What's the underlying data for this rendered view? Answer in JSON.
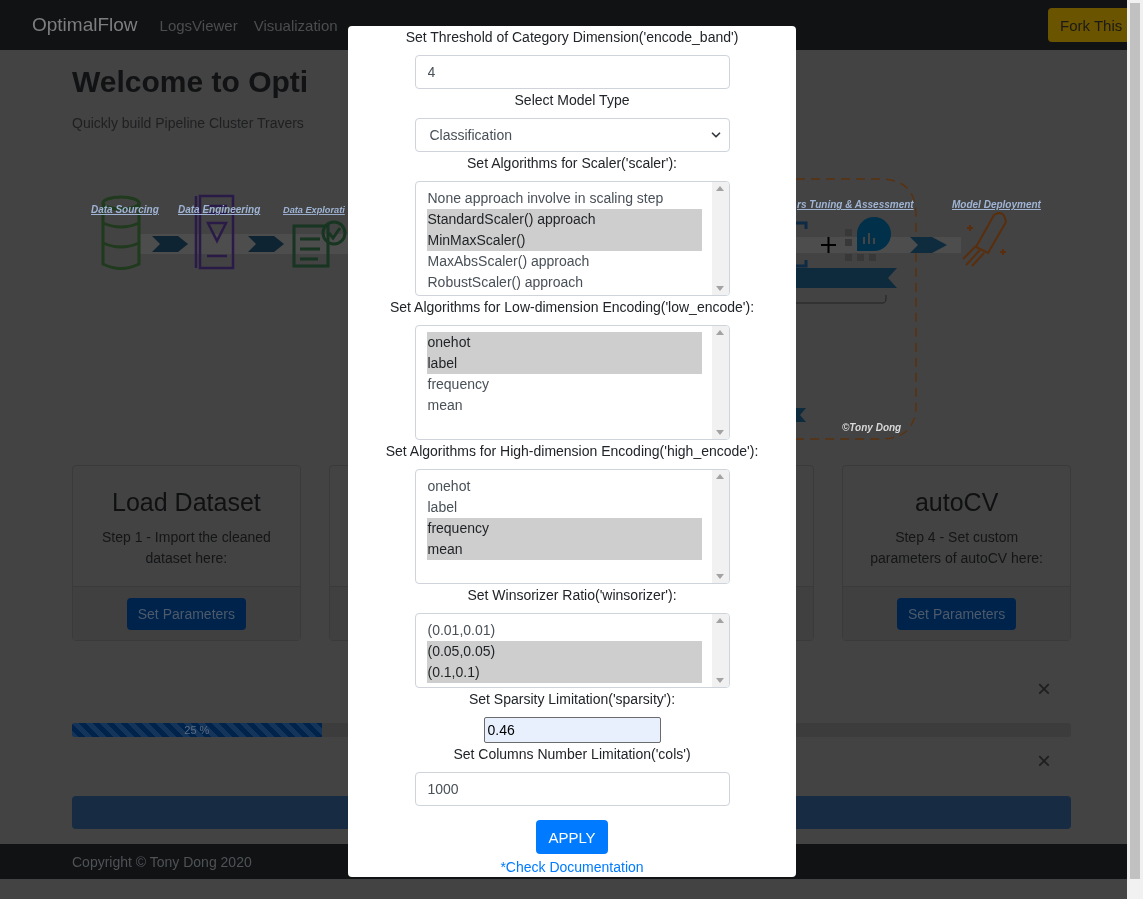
{
  "navbar": {
    "brand": "OptimalFlow",
    "links": [
      {
        "label": "LogsViewer"
      },
      {
        "label": "Visualization"
      }
    ],
    "fork_button": "Fork This"
  },
  "hero": {
    "title": "Welcome to Opti",
    "subtitle": "Quickly build Pipeline Cluster Travers"
  },
  "diagram": {
    "labels": [
      "Data Sourcing",
      "Data Engineering",
      "Data Explorati",
      "rs Tuning & Assessment",
      "Model Deployment"
    ],
    "credit": "©Tony Dong"
  },
  "cards": [
    {
      "title": "Load Dataset",
      "text": "Step 1 - Import the cleaned dataset here:",
      "button": "Set Parameters"
    },
    {
      "title": "autoCV",
      "text": "Step 4 - Set custom parameters of autoCV here:",
      "button": "Set Parameters"
    }
  ],
  "alerts": [
    {
      "close": "×"
    },
    {
      "close": "×"
    }
  ],
  "progress": {
    "level": 0.25,
    "label": "25 %"
  },
  "footer": {
    "copyright": "Copyright © Tony Dong 2020"
  },
  "modal": {
    "fields": [
      {
        "kind": "input",
        "label": "Set Threshold of Category Dimension('encode_band')",
        "value": "4"
      },
      {
        "kind": "select",
        "label": "Select Model Type",
        "value": "Classification"
      },
      {
        "kind": "listbox",
        "label": "Set Algorithms for Scaler('scaler'):",
        "options": [
          {
            "label": "None approach involve in scaling step",
            "selected": false
          },
          {
            "label": "StandardScaler() approach",
            "selected": true
          },
          {
            "label": "MinMaxScaler()",
            "selected": true
          },
          {
            "label": "MaxAbsScaler() approach",
            "selected": false
          },
          {
            "label": "RobustScaler() approach",
            "selected": false
          }
        ]
      },
      {
        "kind": "listbox",
        "label": "Set Algorithms for Low-dimension Encoding('low_encode'):",
        "options": [
          {
            "label": "onehot",
            "selected": true
          },
          {
            "label": "label",
            "selected": true
          },
          {
            "label": "frequency",
            "selected": false
          },
          {
            "label": "mean",
            "selected": false
          }
        ]
      },
      {
        "kind": "listbox",
        "label": "Set Algorithms for High-dimension Encoding('high_encode'):",
        "options": [
          {
            "label": "onehot",
            "selected": false
          },
          {
            "label": "label",
            "selected": false
          },
          {
            "label": "frequency",
            "selected": true
          },
          {
            "label": "mean",
            "selected": true
          }
        ]
      },
      {
        "kind": "listbox",
        "label": "Set Winsorizer Ratio('winsorizer'):",
        "options": [
          {
            "label": "(0.01,0.01)",
            "selected": false
          },
          {
            "label": "(0.05,0.05)",
            "selected": true
          },
          {
            "label": "(0.1,0.1)",
            "selected": true
          }
        ]
      },
      {
        "kind": "plain-input",
        "label": "Set Sparsity Limitation('sparsity'):",
        "value": "0.46"
      },
      {
        "kind": "input",
        "label": "Set Columns Number Limitation('cols')",
        "value": "1000"
      }
    ],
    "apply_button": "APPLY",
    "link": "*Check Documentation"
  }
}
